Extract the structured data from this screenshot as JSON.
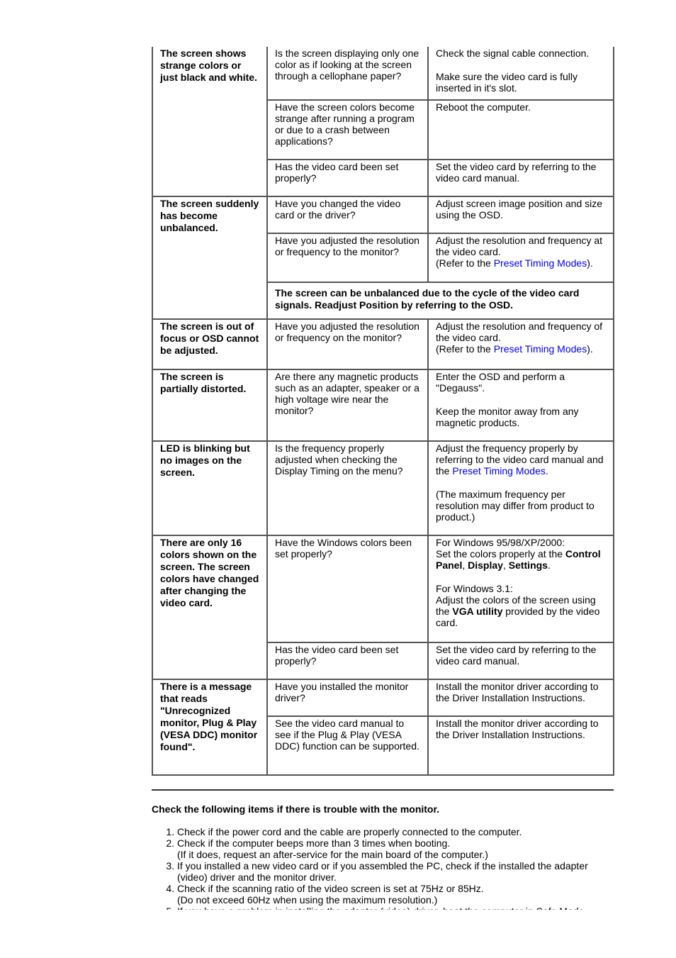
{
  "table": {
    "groups": [
      {
        "symptom": "The screen shows strange colors or just black and white.",
        "rows": [
          {
            "check": [
              [
                {
                  "t": "Is the screen displaying only one color as if looking at the screen through a cellophane paper?"
                }
              ]
            ],
            "solution": [
              [
                {
                  "t": "Check the signal cable connection."
                }
              ],
              [
                {
                  "t": "Make sure the video card is fully inserted in it's slot."
                }
              ]
            ]
          },
          {
            "check": [
              [
                {
                  "t": "Have the screen colors become strange after running a program or due to a crash between applications?"
                }
              ]
            ],
            "solution": [
              [
                {
                  "t": "Reboot the computer."
                }
              ]
            ]
          },
          {
            "check": [
              [
                {
                  "t": "Has the video card been set properly?"
                }
              ]
            ],
            "solution": [
              [
                {
                  "t": "Set the video card by referring to the video card manual."
                }
              ]
            ]
          }
        ]
      },
      {
        "symptom": "The screen suddenly has become unbalanced.",
        "rows": [
          {
            "check": [
              [
                {
                  "t": "Have you changed the video card or the driver?"
                }
              ]
            ],
            "solution": [
              [
                {
                  "t": "Adjust screen image position and size using the OSD."
                }
              ]
            ]
          },
          {
            "check": [
              [
                {
                  "t": "Have you adjusted the resolution or frequency to the monitor?"
                }
              ]
            ],
            "solution": [
              [
                {
                  "t": "Adjust the resolution and frequency at the video card."
                },
                {
                  "br": true
                },
                {
                  "t": "(Refer to the "
                },
                {
                  "t": "Preset Timing Modes",
                  "link": true
                },
                {
                  "t": ")."
                }
              ]
            ]
          },
          {
            "note": "The screen can be unbalanced due to the cycle of the video card signals. Readjust Position by referring to the OSD."
          }
        ]
      },
      {
        "symptom": "The screen is out of focus or OSD cannot be adjusted.",
        "rows": [
          {
            "check": [
              [
                {
                  "t": "Have you adjusted the resolution or frequency on the monitor?"
                }
              ]
            ],
            "solution": [
              [
                {
                  "t": "Adjust the resolution and frequency of the video card."
                },
                {
                  "br": true
                },
                {
                  "t": "(Refer to the "
                },
                {
                  "t": "Preset Timing Modes",
                  "link": true
                },
                {
                  "t": ")."
                }
              ]
            ]
          }
        ]
      },
      {
        "symptom": "The screen is partially distorted.",
        "rows": [
          {
            "check": [
              [
                {
                  "t": "Are there any magnetic products such as an adapter, speaker or a high voltage wire near the monitor?"
                }
              ]
            ],
            "solution": [
              [
                {
                  "t": "Enter the OSD and perform a \"Degauss\"."
                }
              ],
              [
                {
                  "t": "Keep the monitor away from any magnetic products."
                }
              ]
            ]
          }
        ]
      },
      {
        "symptom": "LED is blinking but no images on the screen.",
        "rows": [
          {
            "check": [
              [
                {
                  "t": "Is the frequency properly adjusted when checking the Display Timing on the menu?"
                }
              ]
            ],
            "solution": [
              [
                {
                  "t": "Adjust the frequency properly by referring to the video card manual and the "
                },
                {
                  "t": "Preset Timing Modes",
                  "link": true
                },
                {
                  "t": "."
                }
              ],
              [
                {
                  "t": "(The maximum frequency per resolution may differ from product to product.)"
                }
              ]
            ]
          }
        ]
      },
      {
        "symptom": "There are only 16 colors shown on the screen. The screen colors have changed after changing the video card.",
        "rows": [
          {
            "check": [
              [
                {
                  "t": "Have the Windows colors been set properly?"
                }
              ]
            ],
            "solution": [
              [
                {
                  "t": "For Windows 95/98/XP/2000:"
                },
                {
                  "br": true
                },
                {
                  "t": "Set the colors properly at the "
                },
                {
                  "t": "Control Panel",
                  "b": true
                },
                {
                  "t": ", "
                },
                {
                  "t": "Display",
                  "b": true
                },
                {
                  "t": ", "
                },
                {
                  "t": "Settings",
                  "b": true
                },
                {
                  "t": "."
                }
              ],
              [
                {
                  "t": "For Windows 3.1:"
                },
                {
                  "br": true
                },
                {
                  "t": "Adjust the colors of the screen using the "
                },
                {
                  "t": "VGA utility",
                  "b": true
                },
                {
                  "t": " provided by the video card."
                }
              ]
            ]
          },
          {
            "check": [
              [
                {
                  "t": "Has the video card been set properly?"
                }
              ]
            ],
            "solution": [
              [
                {
                  "t": "Set the video card by referring to the video card manual."
                }
              ]
            ]
          }
        ]
      },
      {
        "symptom": "There is a message that reads \"Unrecognized monitor, Plug & Play (VESA DDC) monitor found\".",
        "rows": [
          {
            "check": [
              [
                {
                  "t": "Have you installed the monitor driver?"
                }
              ]
            ],
            "solution": [
              [
                {
                  "t": "Install the monitor driver according to the Driver Installation Instructions."
                }
              ]
            ]
          },
          {
            "check": [
              [
                {
                  "t": "See the video card manual to see if the Plug & Play (VESA DDC) function can be supported."
                }
              ]
            ],
            "solution": [
              [
                {
                  "t": "Install the monitor driver according to the Driver Installation Instructions."
                }
              ]
            ]
          }
        ]
      }
    ]
  },
  "checklist": {
    "title": "Check the following items if there is trouble with the monitor.",
    "items": [
      [
        "Check if the power cord and the cable are properly connected to the computer."
      ],
      [
        "Check if the computer beeps more than 3 times when booting.",
        "(If it does, request an after-service for the main board of the computer.)"
      ],
      [
        "If you installed a new video card or if you assembled the PC, check if the installed the adapter (video) driver and the monitor driver."
      ],
      [
        "Check if the scanning ratio of the video screen is set at 75Hz or 85Hz.",
        "(Do not exceed 60Hz when using the maximum resolution.)"
      ],
      [
        "If you have a problem in installing the adapter (video) driver, boot the computer in Safe Mode"
      ]
    ]
  },
  "colors": {
    "link": "#0000ee",
    "border": "#555555"
  }
}
